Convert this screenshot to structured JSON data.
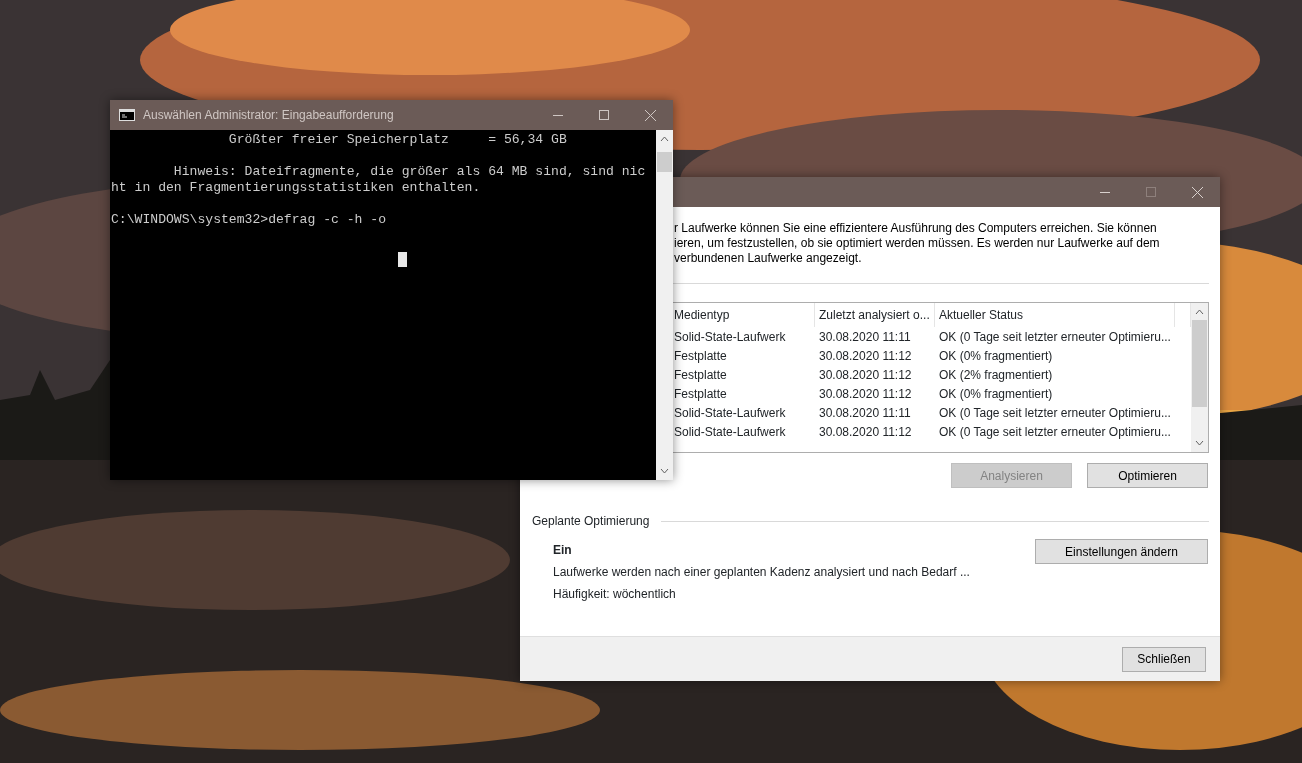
{
  "command_prompt": {
    "title": "Auswählen Administrator: Eingabeaufforderung",
    "paragraphs": [
      [
        "               Größter freier Speicherplatz     = 56,34 GB"
      ],
      [
        "        Hinweis: Dateifragmente, die größer als 64 MB sind, sind nic",
        "ht in den Fragmentierungsstatistiken enthalten."
      ],
      [
        "C:\\WINDOWS\\system32>defrag -c -h -o"
      ]
    ]
  },
  "optimize_window": {
    "intro_lines": [
      "r Laufwerke können Sie eine effizientere Ausführung des Computers erreichen. Sie können",
      "ieren, um festzustellen, ob sie optimiert werden müssen. Es werden nur Laufwerke auf dem",
      "verbundenen Laufwerke angezeigt."
    ],
    "table": {
      "columns": [
        "Medientyp",
        "Zuletzt analysiert o...",
        "Aktueller Status"
      ],
      "rows": [
        {
          "media_type": "Solid-State-Laufwerk",
          "last_analyzed": "30.08.2020 11:11",
          "status": "OK (0 Tage seit letzter erneuter Optimieru...",
          "selected": false
        },
        {
          "media_type": "Festplatte",
          "last_analyzed": "30.08.2020 11:12",
          "status": "OK (0% fragmentiert)",
          "selected": false
        },
        {
          "media_type": "Festplatte",
          "last_analyzed": "30.08.2020 11:12",
          "status": "OK (2% fragmentiert)",
          "selected": false
        },
        {
          "media_type": "Festplatte",
          "last_analyzed": "30.08.2020 11:12",
          "status": "OK (0% fragmentiert)",
          "selected": false
        },
        {
          "media_type": "Solid-State-Laufwerk",
          "last_analyzed": "30.08.2020 11:11",
          "status": "OK (0 Tage seit letzter erneuter Optimieru...",
          "selected": false
        },
        {
          "media_type": "Solid-State-Laufwerk",
          "last_analyzed": "30.08.2020 11:12",
          "status": "OK (0 Tage seit letzter erneuter Optimieru...",
          "selected": false
        }
      ]
    },
    "buttons": [
      {
        "label": "Analysieren",
        "disabled": true
      },
      {
        "label": "Optimieren",
        "disabled": false
      }
    ],
    "scheduled": {
      "heading": "Geplante Optimierung",
      "state": "Ein",
      "description": "Laufwerke werden nach einer geplanten Kadenz analysiert und nach Bedarf ...",
      "frequency": "Häufigkeit: wöchentlich",
      "button": "Einstellungen ändern"
    },
    "close_button": "Schließen"
  }
}
